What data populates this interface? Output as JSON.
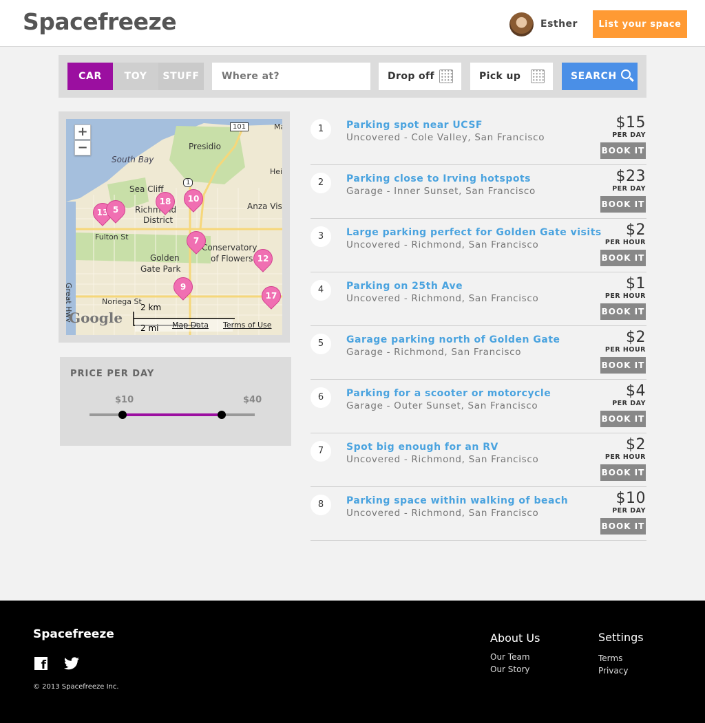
{
  "header": {
    "logo": "Spacefreeze",
    "user_name": "Esther",
    "list_button": "List your space"
  },
  "search": {
    "tabs": [
      "CAR",
      "TOY",
      "STUFF"
    ],
    "active_tab": "CAR",
    "where_placeholder": "Where at?",
    "drop_off": "Drop off",
    "pick_up": "Pick up",
    "search_button": "SEARCH"
  },
  "map": {
    "labels": {
      "presidio": "Presidio",
      "south_bay": "South Bay",
      "sea_cliff": "Sea Cliff",
      "richmond": "Richmond",
      "district": "District",
      "anza": "Anza Vis",
      "fulton": "Fulton St",
      "golden": "Golden",
      "gate_park": "Gate Park",
      "conservatory": "Conservatory",
      "of_flowers": "of Flowers",
      "great_hwy": "Great Hwy",
      "noriega": "Noriega St",
      "hei": "Hei",
      "ma": "Ma",
      "rt_101": "101",
      "rt_1": "1"
    },
    "pins": [
      "13",
      "5",
      "18",
      "10",
      "7",
      "12",
      "9",
      "17"
    ],
    "google": "Google",
    "scale_km": "2 km",
    "scale_mi": "2 mi",
    "map_data": "Map Data",
    "terms": "Terms of Use"
  },
  "price": {
    "title": "PRICE PER DAY",
    "min_label": "$10",
    "max_label": "$40",
    "range_min": 0,
    "range_max": 50,
    "low": 10,
    "high": 40
  },
  "listings": [
    {
      "num": "1",
      "title": "Parking spot near UCSF",
      "subtitle": "Uncovered - Cole Valley, San Francisco",
      "price": "$15",
      "unit": "PER DAY"
    },
    {
      "num": "2",
      "title": "Parking close to Irving hotspots",
      "subtitle": "Garage - Inner Sunset, San Francisco",
      "price": "$23",
      "unit": "PER DAY"
    },
    {
      "num": "3",
      "title": "Large parking perfect for Golden Gate visits",
      "subtitle": "Uncovered - Richmond, San Francisco",
      "price": "$2",
      "unit": "PER HOUR"
    },
    {
      "num": "4",
      "title": "Parking on 25th Ave",
      "subtitle": "Uncovered - Richmond, San Francisco",
      "price": "$1",
      "unit": "PER HOUR"
    },
    {
      "num": "5",
      "title": "Garage parking north of Golden Gate",
      "subtitle": "Garage - Richmond, San Francisco",
      "price": "$2",
      "unit": "PER HOUR"
    },
    {
      "num": "6",
      "title": "Parking for a scooter or motorcycle",
      "subtitle": "Garage - Outer Sunset, San Francisco",
      "price": "$4",
      "unit": "PER DAY"
    },
    {
      "num": "7",
      "title": "Spot big enough for an RV",
      "subtitle": "Uncovered - Richmond, San Francisco",
      "price": "$2",
      "unit": "PER HOUR"
    },
    {
      "num": "8",
      "title": "Parking space within walking of beach",
      "subtitle": "Uncovered - Richmond, San Francisco",
      "price": "$10",
      "unit": "PER DAY"
    }
  ],
  "book_label": "BOOK IT",
  "footer": {
    "logo": "Spacefreeze",
    "copyright": "© 2013  Spacefreeze Inc.",
    "about_title": "About Us",
    "about_links": [
      "Our Team",
      "Our Story"
    ],
    "settings_title": "Settings",
    "settings_links": [
      "Terms",
      "Privacy"
    ]
  },
  "colors": {
    "accent_purple": "#9b0fa0",
    "orange": "#ff9a33",
    "search_blue": "#4a8fe7",
    "link_blue": "#4aa3df",
    "pin_pink": "#f06fb2"
  }
}
